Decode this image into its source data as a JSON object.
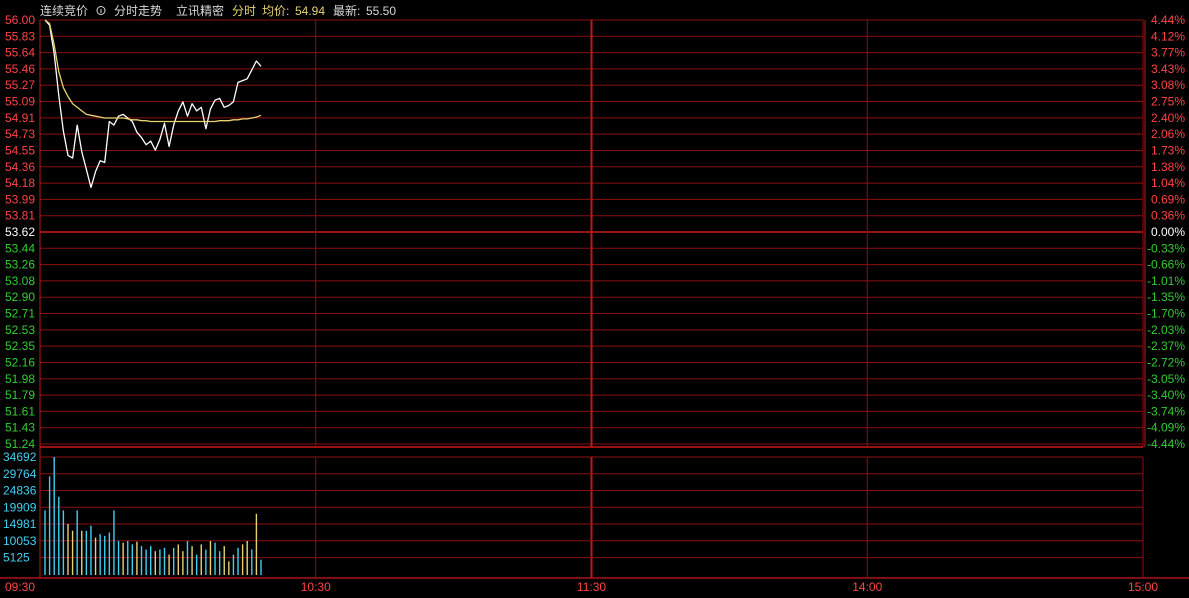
{
  "header": {
    "tab_auction": "连续竞价",
    "tab_minute": "分时走势",
    "tab_source": "立讯精密",
    "label_minute": "分时",
    "label_avg": "均价:",
    "avg_price": "54.94",
    "label_latest": "最新:",
    "latest_price": "55.50"
  },
  "colors": {
    "background": "#000000",
    "grid": "#8c0f0f",
    "up": "#ff4444",
    "down": "#33cc33",
    "neutral": "#ffffff",
    "price_line": "#ffffff",
    "avg_line": "#e8d270",
    "volume_cyan": "#40d0f0",
    "volume_yellow": "#e8d270",
    "axis_text_cyan": "#40d0f0",
    "time_text": "#ff4444"
  },
  "chart_data": [
    {
      "type": "line",
      "title": "",
      "prev_close": 53.62,
      "ylim": [
        51.24,
        56.0
      ],
      "price_ticks": [
        "56.00",
        "55.83",
        "55.64",
        "55.46",
        "55.27",
        "55.09",
        "54.91",
        "54.73",
        "54.55",
        "54.36",
        "54.18",
        "53.99",
        "53.81",
        "53.62",
        "53.44",
        "53.26",
        "53.08",
        "52.90",
        "52.71",
        "52.53",
        "52.35",
        "52.16",
        "51.98",
        "51.79",
        "51.61",
        "51.43",
        "51.24"
      ],
      "pct_ticks": [
        "4.44%",
        "4.12%",
        "3.77%",
        "3.43%",
        "3.08%",
        "2.75%",
        "2.40%",
        "2.06%",
        "1.73%",
        "1.38%",
        "1.04%",
        "0.69%",
        "0.36%",
        "0.00%",
        "-0.33%",
        "-0.66%",
        "-1.01%",
        "-1.35%",
        "-1.70%",
        "-2.03%",
        "-2.37%",
        "-2.72%",
        "-3.05%",
        "-3.40%",
        "-3.74%",
        "-4.09%",
        "-4.44%"
      ],
      "x_ticks": [
        "09:30",
        "10:30",
        "11:30",
        "14:00",
        "15:00"
      ],
      "total_minutes": 240,
      "series": [
        {
          "values": [
            56.0,
            55.94,
            55.62,
            55.15,
            54.75,
            54.48,
            54.45,
            54.82,
            54.52,
            54.32,
            54.12,
            54.3,
            54.42,
            54.4,
            54.86,
            54.82,
            54.92,
            54.94,
            54.9,
            54.86,
            54.74,
            54.68,
            54.6,
            54.64,
            54.54,
            54.66,
            54.84,
            54.58,
            54.82,
            54.98,
            55.08,
            54.92,
            55.06,
            54.98,
            55.02,
            54.78,
            55.0,
            55.1,
            55.12,
            55.02,
            55.04,
            55.08,
            55.3,
            55.32,
            55.34,
            55.44,
            55.54,
            55.48
          ]
        },
        {
          "values": [
            56.0,
            55.96,
            55.72,
            55.42,
            55.24,
            55.14,
            55.06,
            55.02,
            54.98,
            54.94,
            54.93,
            54.92,
            54.91,
            54.9,
            54.9,
            54.9,
            54.9,
            54.9,
            54.89,
            54.88,
            54.88,
            54.87,
            54.87,
            54.86,
            54.86,
            54.86,
            54.86,
            54.86,
            54.86,
            54.86,
            54.86,
            54.86,
            54.86,
            54.86,
            54.86,
            54.86,
            54.86,
            54.86,
            54.87,
            54.87,
            54.87,
            54.88,
            54.88,
            54.89,
            54.89,
            54.9,
            54.91,
            54.93
          ]
        }
      ]
    },
    {
      "type": "bar",
      "title": "",
      "ylim": [
        0,
        34692
      ],
      "y_ticks": [
        "34692",
        "29764",
        "24836",
        "19909",
        "14981",
        "10053",
        "5125"
      ],
      "values": [
        19000,
        29000,
        34692,
        23000,
        19000,
        15000,
        13000,
        19000,
        13000,
        13000,
        14500,
        11000,
        12000,
        11500,
        12500,
        19000,
        10000,
        9500,
        10000,
        9000,
        9800,
        8500,
        7500,
        8500,
        7000,
        7500,
        8000,
        6000,
        8000,
        9000,
        7000,
        10000,
        8500,
        6000,
        9000,
        7500,
        10000,
        9500,
        7000,
        8500,
        4000,
        6000,
        8000,
        9000,
        10000,
        7500,
        18000,
        4500
      ],
      "colors": [
        "cyan",
        "cyan",
        "cyan",
        "cyan",
        "cyan",
        "yellow",
        "yellow",
        "cyan",
        "yellow",
        "cyan",
        "cyan",
        "yellow",
        "cyan",
        "cyan",
        "cyan",
        "cyan",
        "cyan",
        "yellow",
        "cyan",
        "cyan",
        "yellow",
        "cyan",
        "cyan",
        "cyan",
        "yellow",
        "cyan",
        "cyan",
        "yellow",
        "cyan",
        "yellow",
        "yellow",
        "cyan",
        "yellow",
        "cyan",
        "yellow",
        "cyan",
        "yellow",
        "cyan",
        "cyan",
        "yellow",
        "yellow",
        "cyan",
        "cyan",
        "yellow",
        "yellow",
        "cyan",
        "yellow",
        "cyan"
      ]
    }
  ]
}
